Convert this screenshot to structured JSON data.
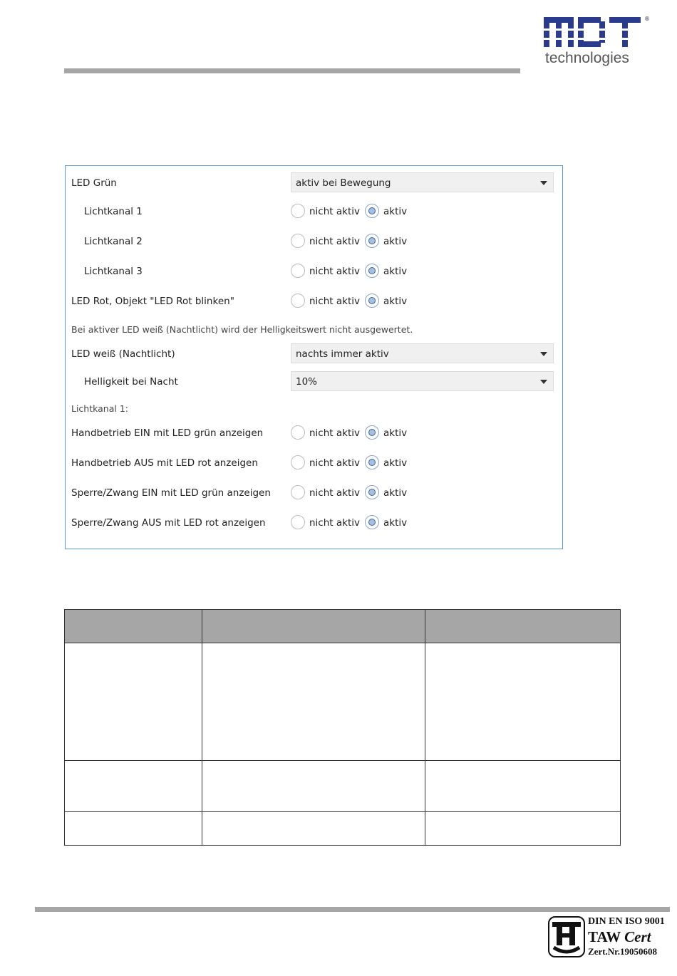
{
  "header": {
    "logo_text": "MDT",
    "logo_sub": "technologies",
    "logo_reg": "®"
  },
  "panel": {
    "led_gruen": {
      "label": "LED Grün",
      "value": "aktiv bei Bewegung"
    },
    "radio_rows": [
      {
        "label": "Lichtkanal 1",
        "off": "nicht aktiv",
        "on": "aktiv",
        "selected": "aktiv"
      },
      {
        "label": "Lichtkanal 2",
        "off": "nicht aktiv",
        "on": "aktiv",
        "selected": "aktiv"
      },
      {
        "label": "Lichtkanal 3",
        "off": "nicht aktiv",
        "on": "aktiv",
        "selected": "aktiv"
      },
      {
        "label": "LED Rot, Objekt \"LED Rot blinken\"",
        "off": "nicht aktiv",
        "on": "aktiv",
        "selected": "aktiv"
      }
    ],
    "note": "Bei aktiver LED weiß (Nachtlicht) wird der Helligkeitswert nicht ausgewertet.",
    "led_weiss": {
      "label": "LED weiß (Nachtlicht)",
      "value": "nachts immer aktiv"
    },
    "helligkeit": {
      "label": "Helligkeit bei Nacht",
      "value": "10%"
    },
    "section_label": "Lichtkanal 1:",
    "radio_rows2": [
      {
        "label": "Handbetrieb EIN mit LED grün anzeigen",
        "off": "nicht aktiv",
        "on": "aktiv",
        "selected": "aktiv"
      },
      {
        "label": "Handbetrieb AUS mit LED rot anzeigen",
        "off": "nicht aktiv",
        "on": "aktiv",
        "selected": "aktiv"
      },
      {
        "label": "Sperre/Zwang EIN mit LED grün anzeigen",
        "off": "nicht aktiv",
        "on": "aktiv",
        "selected": "aktiv"
      },
      {
        "label": "Sperre/Zwang AUS mit LED rot anzeigen",
        "off": "nicht aktiv",
        "on": "aktiv",
        "selected": "aktiv"
      }
    ]
  },
  "footer": {
    "cert_line1": "DIN EN ISO 9001",
    "cert_line2a": "TAW",
    "cert_line2b": "Cert",
    "cert_line3": "Zert.Nr.19050608"
  },
  "colors": {
    "brand_blue": "#2a3a8c",
    "panel_border": "#5b9bd5",
    "bar_gray": "#a6a6a6"
  }
}
